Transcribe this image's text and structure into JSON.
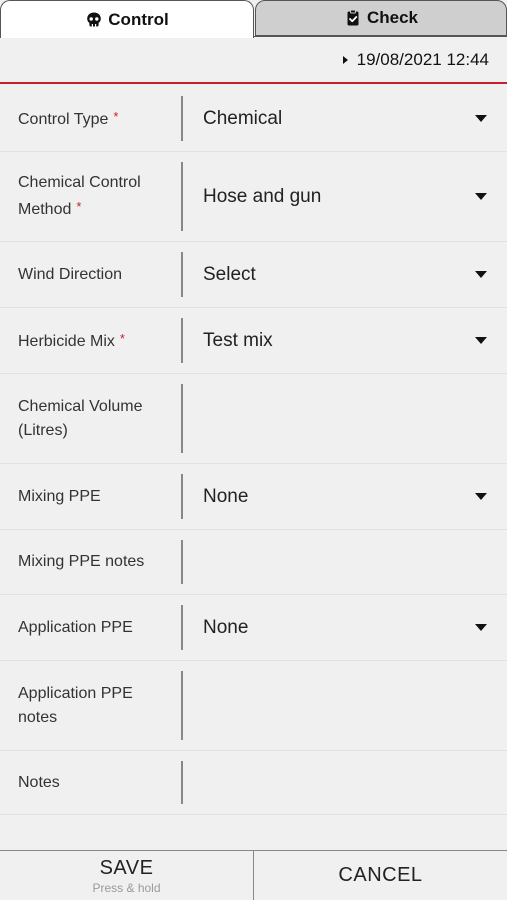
{
  "tabs": [
    {
      "label": "Control",
      "icon": "skull-icon",
      "active": true
    },
    {
      "label": "Check",
      "icon": "clipboard-check-icon",
      "active": false
    }
  ],
  "datetime": "19/08/2021 12:44",
  "form": {
    "rows": [
      {
        "label": "Control Type",
        "required": true,
        "value": "Chemical",
        "dropdown": true
      },
      {
        "label": "Chemical Control Method",
        "required": true,
        "value": "Hose and gun",
        "dropdown": true
      },
      {
        "label": "Wind Direction",
        "required": false,
        "value": "Select",
        "dropdown": true
      },
      {
        "label": "Herbicide Mix",
        "required": true,
        "value": "Test mix",
        "dropdown": true
      },
      {
        "label": "Chemical Volume (Litres)",
        "required": false,
        "value": "",
        "dropdown": false
      },
      {
        "label": "Mixing PPE",
        "required": false,
        "value": "None",
        "dropdown": true
      },
      {
        "label": "Mixing PPE notes",
        "required": false,
        "value": "",
        "dropdown": false
      },
      {
        "label": "Application PPE",
        "required": false,
        "value": "None",
        "dropdown": true
      },
      {
        "label": "Application PPE notes",
        "required": false,
        "value": "",
        "dropdown": false
      },
      {
        "label": "Notes",
        "required": false,
        "value": "",
        "dropdown": false
      }
    ],
    "required_marker": "*"
  },
  "footer": {
    "save_label": "SAVE",
    "save_hint": "Press & hold",
    "cancel_label": "CANCEL"
  },
  "colors": {
    "accent": "#c8202e",
    "background": "#f0f0f0"
  }
}
